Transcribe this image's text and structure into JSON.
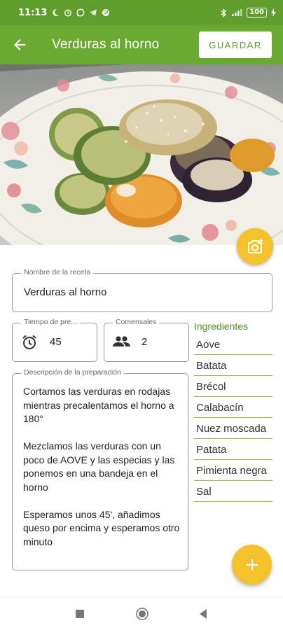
{
  "status_bar": {
    "time": "11:13",
    "battery": "100"
  },
  "app_bar": {
    "title": "Verduras al horno",
    "save_label": "GUARDAR"
  },
  "photo": {
    "description_icon": "camera-add-icon"
  },
  "form": {
    "name": {
      "label": "Nombre de la receta",
      "value": "Verduras al horno"
    },
    "time": {
      "label": "Tiempo de pre...",
      "value": "45",
      "icon": "alarm-clock-icon"
    },
    "diners": {
      "label": "Comensales",
      "value": "2",
      "icon": "people-icon"
    },
    "description": {
      "label": "Descripción de la preparación",
      "value": "Cortamos las verduras en rodajas mientras precalentamos el horno a 180°\n\nMezclamos las verduras con un poco de AOVE y las especias y las ponemos en una bandeja en el horno\n\nEsperamos unos 45', añadimos queso por encima y esperamos otro minuto"
    }
  },
  "ingredients": {
    "title": "Ingredientes",
    "items": [
      "Aove",
      "Batata",
      "Brécol",
      "Calabacín",
      "Nuez moscada",
      "Patata",
      "Pimienta negra",
      "Sal"
    ]
  },
  "colors": {
    "primary": "#6aaa30",
    "status": "#5f9e2b",
    "accent": "#f6c22b",
    "ingredient_title": "#4f8d1f"
  }
}
